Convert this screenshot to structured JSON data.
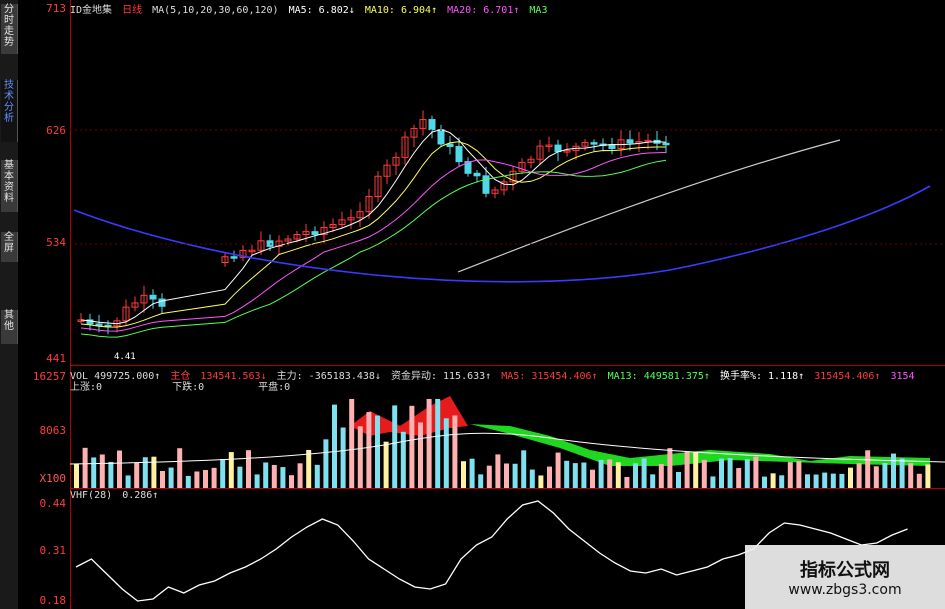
{
  "sidebar": {
    "tabs": [
      {
        "label": "分时走势",
        "active": false
      },
      {
        "label": "技术分析",
        "active": true
      },
      {
        "label": "基本资料",
        "active": false
      },
      {
        "label": "全屏",
        "active": false
      },
      {
        "label": "其他",
        "active": false
      }
    ]
  },
  "price_panel": {
    "title": "ID金地集",
    "period": "日线",
    "ma_params": "MA(5,10,20,30,60,120)",
    "ma5": "MA5: 6.802↓",
    "ma10": "MA10: 6.904↑",
    "ma20": "MA20: 6.701↑",
    "ma30": "MA3",
    "low_label": "4.41",
    "axis_ticks": [
      "713",
      "626",
      "534",
      "441"
    ]
  },
  "volume_panel": {
    "vol": "VOL  499725.000↑",
    "zhu_cang": "主仓",
    "val1": "134541.563↓",
    "zhu_li": "主力: -365183.438↓",
    "zijin": "资金异动: 115.633↑",
    "ma5": "MA5: 315454.406↑",
    "ma13": "MA13: 449581.375↑",
    "turnover": "换手率%: 1.118↑",
    "extra": "315454.406↑",
    "extra2": "3154",
    "shang_zhang": "上涨:0",
    "xia_die": "下跌:0",
    "ping_pan": "平盘:0",
    "axis_ticks": [
      "16257",
      "8063",
      "X100"
    ]
  },
  "vhf_panel": {
    "label": "VHF(28)",
    "value": "0.286↑",
    "axis_ticks": [
      "0.44",
      "0.31",
      "0.18"
    ]
  },
  "watermark": {
    "line1": "指标公式网",
    "line2": "www.zbgs3.com"
  },
  "colors": {
    "up": "#ff3b3b",
    "down": "#4fd8e8",
    "ma5": "#ffffff",
    "ma10": "#ffff55",
    "ma20": "#ff55ff",
    "ma30": "#55ff55",
    "ma60": "#cccccc",
    "ma120": "#3a3aff"
  }
}
